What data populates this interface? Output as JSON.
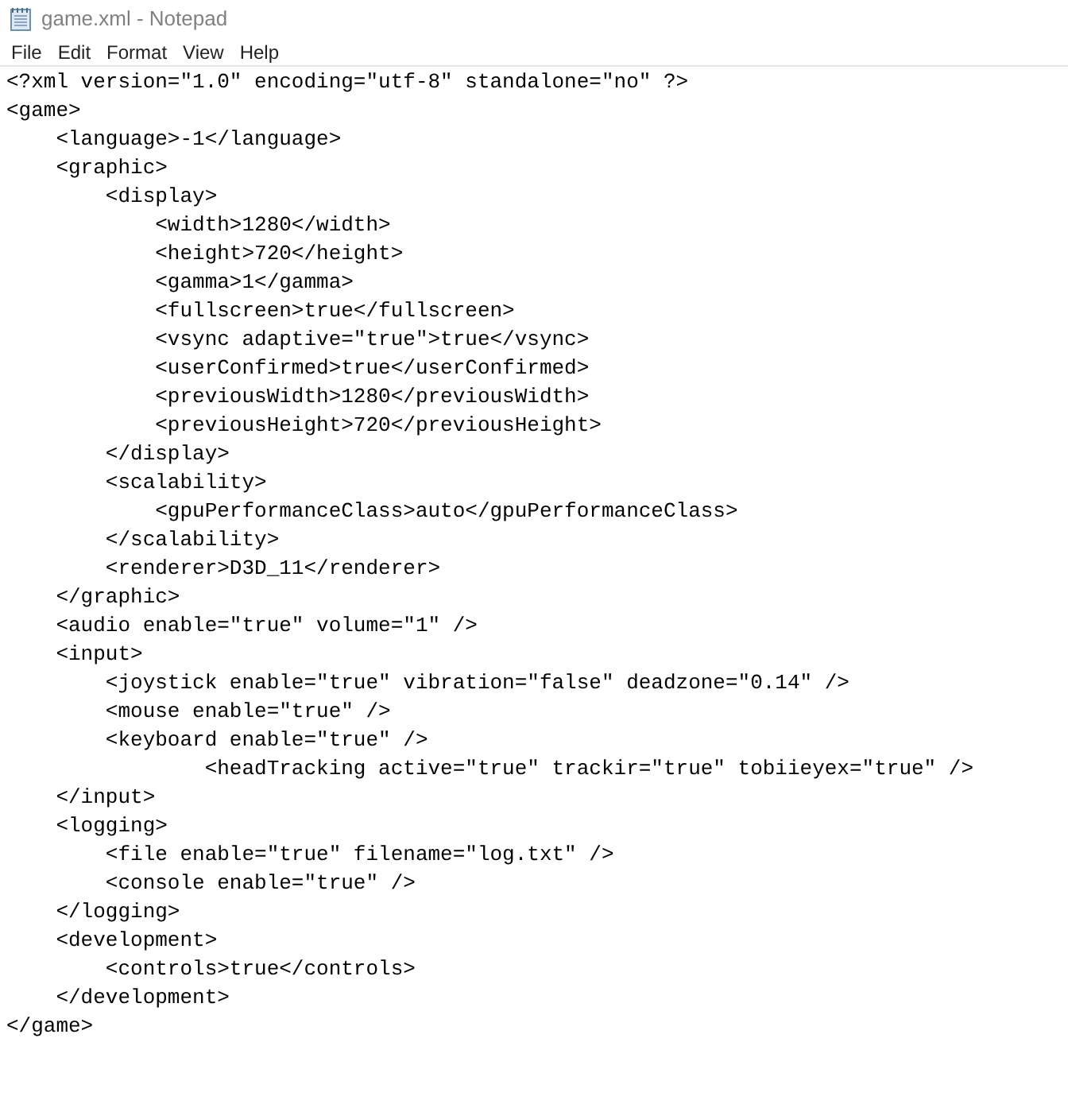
{
  "window": {
    "title": "game.xml - Notepad"
  },
  "menu": [
    "File",
    "Edit",
    "Format",
    "View",
    "Help"
  ],
  "lines": [
    "<?xml version=\"1.0\" encoding=\"utf-8\" standalone=\"no\" ?>",
    "<game>",
    "    <language>-1</language>",
    "    <graphic>",
    "        <display>",
    "            <width>1280</width>",
    "            <height>720</height>",
    "            <gamma>1</gamma>",
    "            <fullscreen>true</fullscreen>",
    "            <vsync adaptive=\"true\">true</vsync>",
    "            <userConfirmed>true</userConfirmed>",
    "            <previousWidth>1280</previousWidth>",
    "            <previousHeight>720</previousHeight>",
    "        </display>",
    "        <scalability>",
    "            <gpuPerformanceClass>auto</gpuPerformanceClass>",
    "        </scalability>",
    "        <renderer>D3D_11</renderer>",
    "    </graphic>",
    "    <audio enable=\"true\" volume=\"1\" />",
    "    <input>",
    "        <joystick enable=\"true\" vibration=\"false\" deadzone=\"0.14\" />",
    "        <mouse enable=\"true\" />",
    "        <keyboard enable=\"true\" />",
    "                <headTracking active=\"true\" trackir=\"true\" tobiieyex=\"true\" />",
    "    </input>",
    "    <logging>",
    "        <file enable=\"true\" filename=\"log.txt\" />",
    "        <console enable=\"true\" />",
    "    </logging>",
    "    <development>",
    "        <controls>true</controls>",
    "    </development>",
    "</game>"
  ]
}
